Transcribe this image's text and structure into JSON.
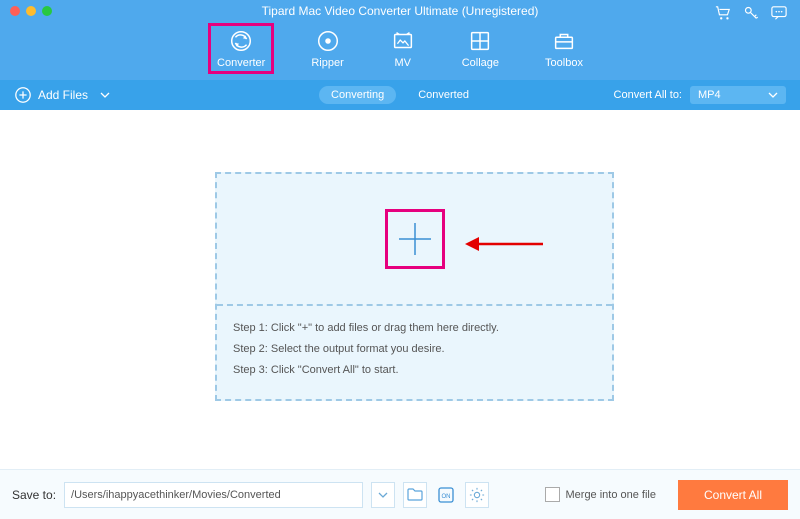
{
  "window": {
    "title": "Tipard Mac Video Converter Ultimate (Unregistered)"
  },
  "tabs": {
    "converter": "Converter",
    "ripper": "Ripper",
    "mv": "MV",
    "collage": "Collage",
    "toolbox": "Toolbox",
    "active": "converter"
  },
  "subbar": {
    "add_files": "Add Files",
    "converting": "Converting",
    "converted": "Converted",
    "convert_all_to_label": "Convert All to:",
    "format": "MP4"
  },
  "dropzone": {
    "step1": "Step 1: Click \"+\" to add files or drag them here directly.",
    "step2": "Step 2: Select the output format you desire.",
    "step3": "Step 3: Click \"Convert All\" to start."
  },
  "footer": {
    "save_to_label": "Save to:",
    "save_path": "/Users/ihappyacethinker/Movies/Converted",
    "merge_label": "Merge into one file",
    "convert_all": "Convert All"
  },
  "colors": {
    "accent": "#4fa9ed",
    "highlight": "#e6007e",
    "primary_btn": "#ff7a3f"
  }
}
